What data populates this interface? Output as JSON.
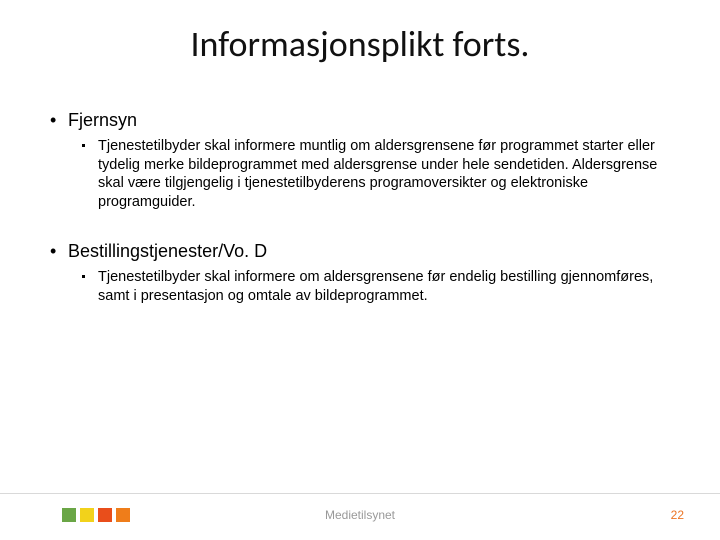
{
  "title": "Informasjonsplikt forts.",
  "bullets": {
    "one": {
      "heading": "Fjernsyn",
      "body": "Tjenestetilbyder skal informere muntlig om aldersgrensene før programmet starter eller tydelig merke bildeprogrammet med aldersgrense under hele sendetiden. Aldersgrense skal være tilgjengelig i tjenestetilbyderens programoversikter og elektroniske programguider."
    },
    "two": {
      "heading": "Bestillingstjenester/Vo. D",
      "body": "Tjenestetilbyder skal informere om aldersgrensene før endelig bestilling gjennomføres, samt i presentasjon og omtale av bildeprogrammet."
    }
  },
  "footer": {
    "org": "Medietilsynet",
    "page": "22"
  },
  "brand_colors": {
    "c1": "#6aa646",
    "c2": "#f2d21b",
    "c3": "#e94e1b",
    "c4": "#ef7d1a"
  }
}
